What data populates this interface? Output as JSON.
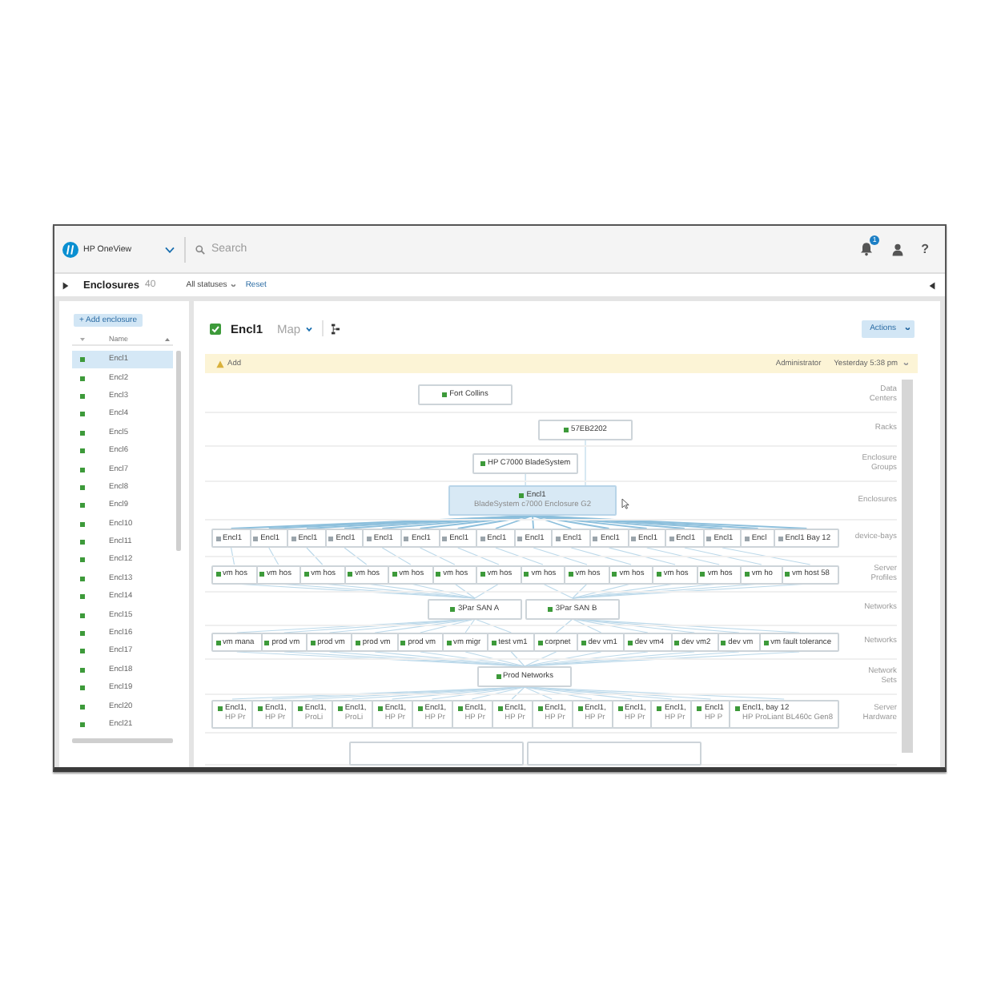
{
  "header": {
    "product": "HP OneView",
    "search": {
      "placeholder": "Search"
    },
    "notifications": "1",
    "help": "?"
  },
  "subheader": {
    "title": "Enclosures",
    "count": "40",
    "filter": "All statuses",
    "reset": "Reset"
  },
  "list": {
    "add_button": "+ Add enclosure",
    "column": "Name",
    "rows": [
      {
        "name": "Encl1",
        "selected": true
      },
      {
        "name": "Encl2",
        "selected": false
      },
      {
        "name": "Encl3",
        "selected": false
      },
      {
        "name": "Encl4",
        "selected": false
      },
      {
        "name": "Encl5",
        "selected": false
      },
      {
        "name": "Encl6",
        "selected": false
      },
      {
        "name": "Encl7",
        "selected": false
      },
      {
        "name": "Encl8",
        "selected": false
      },
      {
        "name": "Encl9",
        "selected": false
      },
      {
        "name": "Encl10",
        "selected": false
      },
      {
        "name": "Encl11",
        "selected": false
      },
      {
        "name": "Encl12",
        "selected": false
      },
      {
        "name": "Encl13",
        "selected": false
      },
      {
        "name": "Encl14",
        "selected": false
      },
      {
        "name": "Encl15",
        "selected": false
      },
      {
        "name": "Encl16",
        "selected": false
      },
      {
        "name": "Encl17",
        "selected": false
      },
      {
        "name": "Encl18",
        "selected": false
      },
      {
        "name": "Encl19",
        "selected": false
      },
      {
        "name": "Encl20",
        "selected": false
      },
      {
        "name": "Encl21",
        "selected": false
      }
    ]
  },
  "detail": {
    "title": "Encl1",
    "view": "Map",
    "actions": "Actions",
    "activity": {
      "message": "Add",
      "user": "Administrator",
      "time": "Yesterday 5:38 pm"
    },
    "map": {
      "tiers": [
        {
          "label": "Data Centers",
          "nodes": [
            {
              "label": "Fort Collins",
              "color": "#3d9a3a",
              "selected": false
            }
          ]
        },
        {
          "label": "Racks",
          "nodes": [
            {
              "label": "57EB2202",
              "color": "#3d9a3a",
              "selected": false
            }
          ]
        },
        {
          "label": "Enclosure Groups",
          "nodes": [
            {
              "label": "HP C7000 BladeSystem",
              "color": "#3d9a3a",
              "selected": false
            }
          ]
        },
        {
          "label": "Enclosures",
          "nodes": [
            {
              "label": "Encl1",
              "sublabel": "BladeSystem c7000 Enclosure G2",
              "color": "#3d9a3a",
              "selected": true
            }
          ]
        },
        {
          "label": "device-bays",
          "nodes": [
            {
              "label": "Encl1",
              "color": "#9aa4ab",
              "selected": false
            },
            {
              "label": "Encl1",
              "color": "#9aa4ab",
              "selected": false
            },
            {
              "label": "Encl1",
              "color": "#9aa4ab",
              "selected": false
            },
            {
              "label": "Encl1",
              "color": "#9aa4ab",
              "selected": false
            },
            {
              "label": "Encl1",
              "color": "#9aa4ab",
              "selected": false
            },
            {
              "label": "Encl1",
              "color": "#9aa4ab",
              "selected": false
            },
            {
              "label": "Encl1",
              "color": "#9aa4ab",
              "selected": false
            },
            {
              "label": "Encl1",
              "color": "#9aa4ab",
              "selected": false
            },
            {
              "label": "Encl1",
              "color": "#9aa4ab",
              "selected": false
            },
            {
              "label": "Encl1",
              "color": "#9aa4ab",
              "selected": false
            },
            {
              "label": "Encl1",
              "color": "#9aa4ab",
              "selected": false
            },
            {
              "label": "Encl1",
              "color": "#9aa4ab",
              "selected": false
            },
            {
              "label": "Encl1",
              "color": "#9aa4ab",
              "selected": false
            },
            {
              "label": "Encl1",
              "color": "#9aa4ab",
              "selected": false
            },
            {
              "label": "Encl",
              "color": "#9aa4ab",
              "selected": false
            },
            {
              "label": "Encl1 Bay 12",
              "color": "#9aa4ab",
              "selected": false
            }
          ]
        },
        {
          "label": "Server Profiles",
          "nodes": [
            {
              "label": "vm hos",
              "color": "#3d9a3a",
              "selected": false
            },
            {
              "label": "vm hos",
              "color": "#3d9a3a",
              "selected": false
            },
            {
              "label": "vm hos",
              "color": "#3d9a3a",
              "selected": false
            },
            {
              "label": "vm hos",
              "color": "#3d9a3a",
              "selected": false
            },
            {
              "label": "vm hos",
              "color": "#3d9a3a",
              "selected": false
            },
            {
              "label": "vm hos",
              "color": "#3d9a3a",
              "selected": false
            },
            {
              "label": "vm hos",
              "color": "#3d9a3a",
              "selected": false
            },
            {
              "label": "vm hos",
              "color": "#3d9a3a",
              "selected": false
            },
            {
              "label": "vm hos",
              "color": "#3d9a3a",
              "selected": false
            },
            {
              "label": "vm hos",
              "color": "#3d9a3a",
              "selected": false
            },
            {
              "label": "vm hos",
              "color": "#3d9a3a",
              "selected": false
            },
            {
              "label": "vm hos",
              "color": "#3d9a3a",
              "selected": false
            },
            {
              "label": "vm ho",
              "color": "#3d9a3a",
              "selected": false
            },
            {
              "label": "vm host 58",
              "color": "#3d9a3a",
              "selected": false
            }
          ]
        },
        {
          "label": "Networks",
          "nodes": [
            {
              "label": "3Par SAN A",
              "color": "#3d9a3a",
              "selected": false
            },
            {
              "label": "3Par SAN B",
              "color": "#3d9a3a",
              "selected": false
            }
          ]
        },
        {
          "label": "Networks",
          "nodes": [
            {
              "label": "vm mana",
              "color": "#3d9a3a",
              "selected": false
            },
            {
              "label": "prod vm",
              "color": "#3d9a3a",
              "selected": false
            },
            {
              "label": "prod vm",
              "color": "#3d9a3a",
              "selected": false
            },
            {
              "label": "prod vm",
              "color": "#3d9a3a",
              "selected": false
            },
            {
              "label": "prod vm",
              "color": "#3d9a3a",
              "selected": false
            },
            {
              "label": "vm migr",
              "color": "#3d9a3a",
              "selected": false
            },
            {
              "label": "test vm1",
              "color": "#3d9a3a",
              "selected": false
            },
            {
              "label": "corpnet",
              "color": "#3d9a3a",
              "selected": false
            },
            {
              "label": "dev vm1",
              "color": "#3d9a3a",
              "selected": false
            },
            {
              "label": "dev vm4",
              "color": "#3d9a3a",
              "selected": false
            },
            {
              "label": "dev vm2",
              "color": "#3d9a3a",
              "selected": false
            },
            {
              "label": "dev vm",
              "color": "#3d9a3a",
              "selected": false
            },
            {
              "label": "vm fault tolerance",
              "color": "#3d9a3a",
              "selected": false
            }
          ]
        },
        {
          "label": "Network Sets",
          "nodes": [
            {
              "label": "Prod Networks",
              "color": "#3d9a3a",
              "selected": false
            }
          ]
        },
        {
          "label": "Server Hardware",
          "nodes": [
            {
              "label": "Encl1,",
              "sublabel": "HP Pr",
              "color": "#3d9a3a",
              "selected": false
            },
            {
              "label": "Encl1,",
              "sublabel": "HP Pr",
              "color": "#3d9a3a",
              "selected": false
            },
            {
              "label": "Encl1,",
              "sublabel": "ProLi",
              "color": "#3d9a3a",
              "selected": false
            },
            {
              "label": "Encl1,",
              "sublabel": "ProLi",
              "color": "#3d9a3a",
              "selected": false
            },
            {
              "label": "Encl1,",
              "sublabel": "HP Pr",
              "color": "#3d9a3a",
              "selected": false
            },
            {
              "label": "Encl1,",
              "sublabel": "HP Pr",
              "color": "#3d9a3a",
              "selected": false
            },
            {
              "label": "Encl1,",
              "sublabel": "HP Pr",
              "color": "#3d9a3a",
              "selected": false
            },
            {
              "label": "Encl1,",
              "sublabel": "HP Pr",
              "color": "#3d9a3a",
              "selected": false
            },
            {
              "label": "Encl1,",
              "sublabel": "HP Pr",
              "color": "#3d9a3a",
              "selected": false
            },
            {
              "label": "Encl1,",
              "sublabel": "HP Pr",
              "color": "#3d9a3a",
              "selected": false
            },
            {
              "label": "Encl1,",
              "sublabel": "HP Pr",
              "color": "#3d9a3a",
              "selected": false
            },
            {
              "label": "Encl1,",
              "sublabel": "HP Pr",
              "color": "#3d9a3a",
              "selected": false
            },
            {
              "label": "Encl1",
              "sublabel": "HP P",
              "color": "#3d9a3a",
              "selected": false
            },
            {
              "label": "Encl1, bay 12",
              "sublabel": "HP ProLiant BL460c Gen8",
              "color": "#3d9a3a",
              "selected": false
            }
          ]
        },
        {
          "nodes": [
            {
              "selected": false
            },
            {
              "selected": false
            }
          ]
        }
      ]
    }
  }
}
